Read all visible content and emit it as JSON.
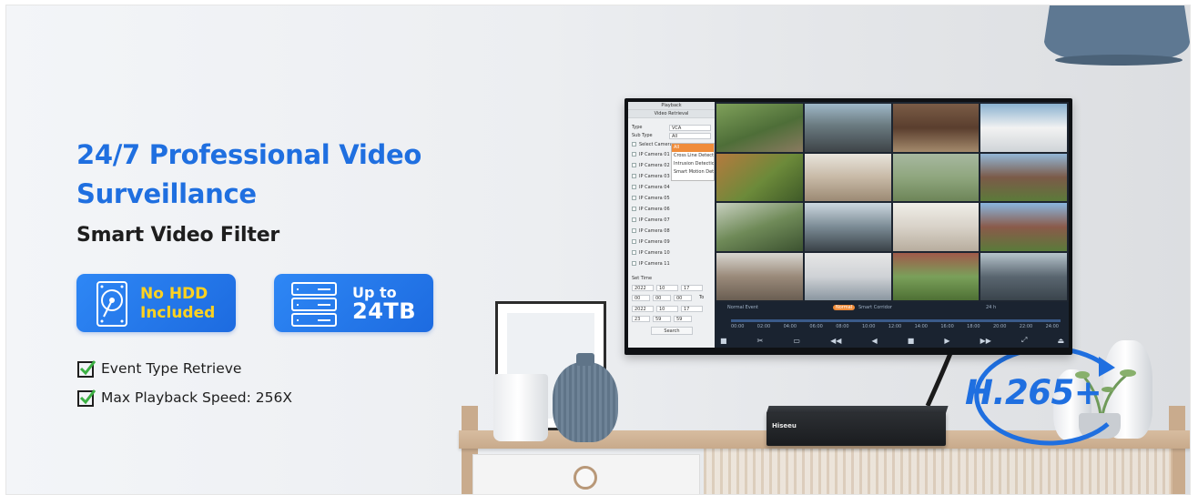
{
  "promo": {
    "headline": "24/7 Professional Video Surveillance",
    "subhead": "Smart Video Filter",
    "badges": {
      "hdd": "No HDD Included",
      "storage_top": "Up to",
      "storage_value": "24TB"
    },
    "features": [
      "Event Type Retrieve",
      "Max Playback Speed: 256X"
    ],
    "codec": "H.265+"
  },
  "device": {
    "brand": "Hiseeu"
  },
  "screen": {
    "panel_title": "Playback",
    "panel_sub": "Video Retrieval",
    "type_label": "Type",
    "type_value": "VCA",
    "subtype_label": "Sub Type",
    "subtype_value": "All",
    "select_all": "Select Camera",
    "dropdown": [
      "All",
      "Cross Line Detection",
      "Intrusion Detection",
      "Smart Motion Detection"
    ],
    "cameras": [
      "IP Camera 01",
      "IP Camera 02",
      "IP Camera 03",
      "IP Camera 04",
      "IP Camera 05",
      "IP Camera 06",
      "IP Camera 07",
      "IP Camera 08",
      "IP Camera 09",
      "IP Camera 10",
      "IP Camera 11"
    ],
    "set_time": "Set Time",
    "start_date": [
      "2022",
      "10",
      "17"
    ],
    "start_time": [
      "00",
      "00",
      "00"
    ],
    "to_label": "To",
    "end_date": [
      "2022",
      "10",
      "17"
    ],
    "end_time": [
      "23",
      "59",
      "59"
    ],
    "search": "Search",
    "modes": "Normal  Event",
    "mode_pill": "Normal",
    "mode_extra": "Smart  Corridor",
    "zoom": "24 h",
    "time_ticks": [
      "00:00",
      "02:00",
      "04:00",
      "06:00",
      "08:00",
      "10:00",
      "12:00",
      "14:00",
      "16:00",
      "18:00",
      "20:00",
      "22:00",
      "24:00"
    ]
  },
  "colors": {
    "brand_blue": "#1f6fe0",
    "badge_yellow": "#ffd21f",
    "accent_orange": "#f08c3a"
  }
}
